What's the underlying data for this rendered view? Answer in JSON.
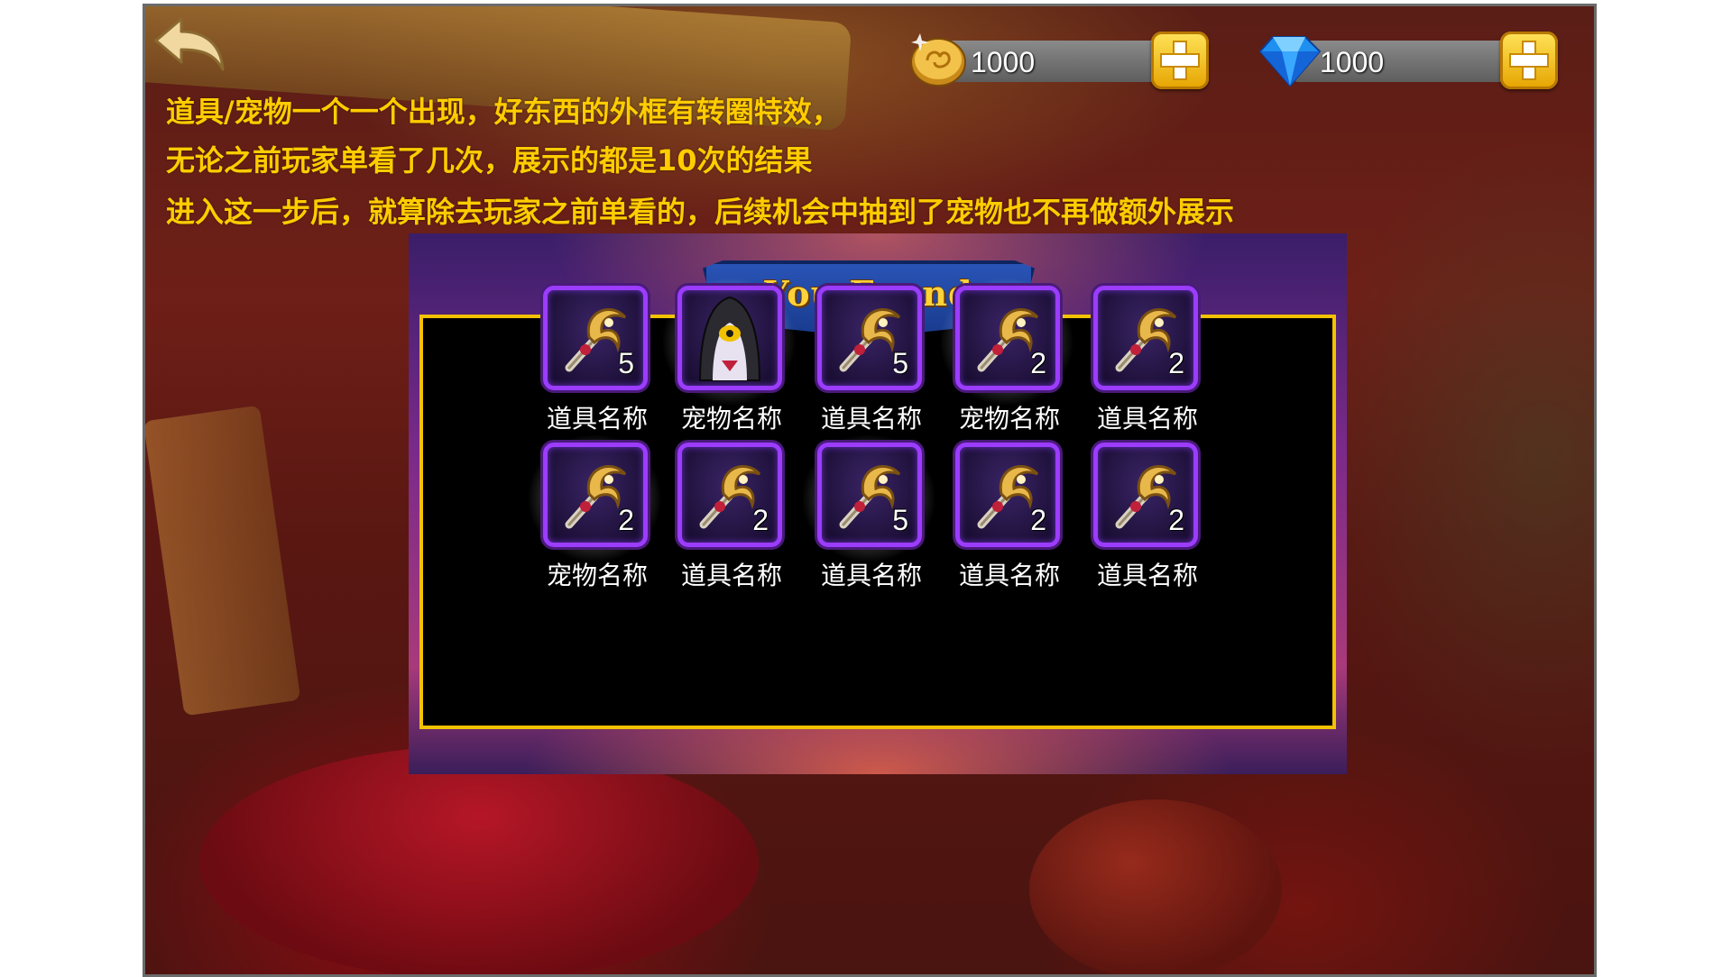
{
  "currencies": {
    "coin": {
      "amount": "1000"
    },
    "gem": {
      "amount": "1000"
    }
  },
  "notes": [
    "道具/宠物一个一个出现，好东西的外框有转圈特效，",
    "无论之前玩家单看了几次，展示的都是10次的结果",
    "进入这一步后，就算除去玩家之前单看的，后续机会中抽到了宠物也不再做额外展示"
  ],
  "popup": {
    "title": "You Found",
    "items": [
      {
        "label": "道具名称",
        "count": "5",
        "type": "item",
        "rare": false
      },
      {
        "label": "宠物名称",
        "count": "",
        "type": "pet",
        "rare": true
      },
      {
        "label": "道具名称",
        "count": "5",
        "type": "item",
        "rare": false
      },
      {
        "label": "宠物名称",
        "count": "2",
        "type": "item",
        "rare": true
      },
      {
        "label": "道具名称",
        "count": "2",
        "type": "item",
        "rare": false
      },
      {
        "label": "宠物名称",
        "count": "2",
        "type": "item",
        "rare": true
      },
      {
        "label": "道具名称",
        "count": "2",
        "type": "item",
        "rare": false
      },
      {
        "label": "道具名称",
        "count": "5",
        "type": "item",
        "rare": true
      },
      {
        "label": "道具名称",
        "count": "2",
        "type": "item",
        "rare": false
      },
      {
        "label": "道具名称",
        "count": "2",
        "type": "item",
        "rare": false
      }
    ]
  },
  "icons": {
    "back": "back-arrow-icon",
    "coin": "gold-coin-icon",
    "gem": "blue-diamond-icon",
    "plus": "plus-icon",
    "item": "golden-scepter-icon",
    "pet": "hooded-pet-icon"
  },
  "colors": {
    "note_text": "#ffcc00",
    "panel_border": "#f2c200",
    "slot_border": "#9b3cff",
    "title_text": "#ffd23a"
  }
}
